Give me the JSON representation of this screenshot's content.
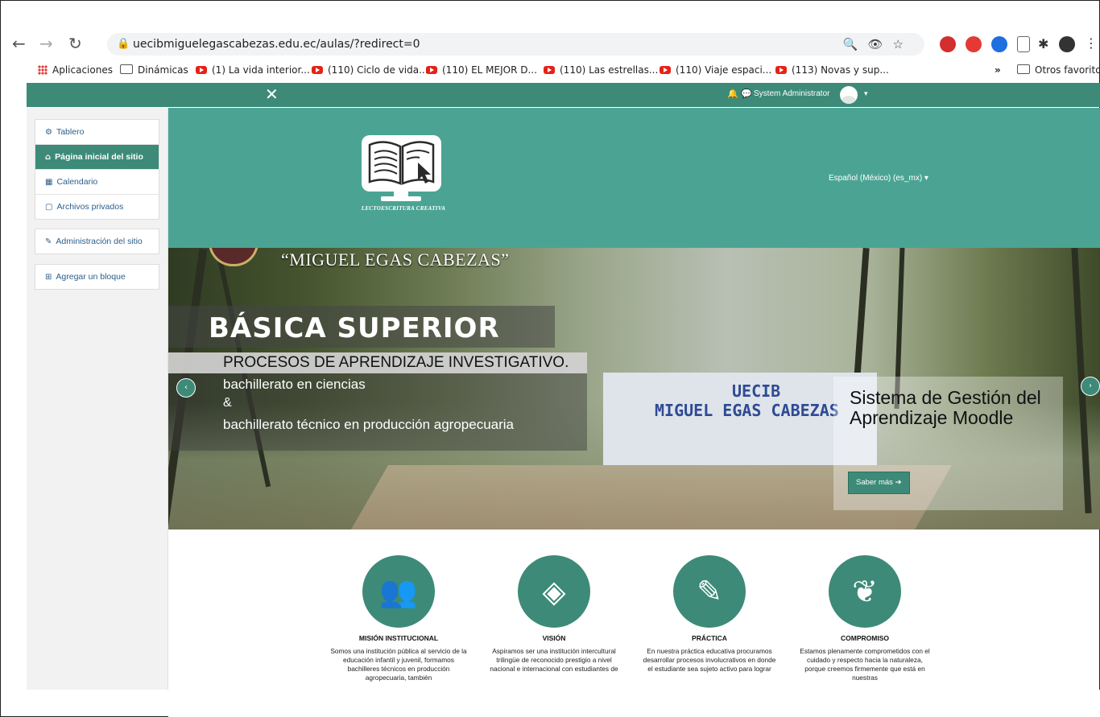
{
  "browser": {
    "url": "uecibmiguelegascabezas.edu.ec/aulas/?redirect=0",
    "bookmarks": [
      {
        "label": "Aplicaciones",
        "type": "apps"
      },
      {
        "label": "Dinámicas",
        "type": "folder"
      },
      {
        "label": "(1) La vida interior...",
        "type": "youtube"
      },
      {
        "label": "(110) Ciclo de vida...",
        "type": "youtube"
      },
      {
        "label": "(110) EL MEJOR D...",
        "type": "youtube"
      },
      {
        "label": "(110) Las estrellas...",
        "type": "youtube"
      },
      {
        "label": "(110) Viaje espaci...",
        "type": "youtube"
      },
      {
        "label": "(113) Novas y sup...",
        "type": "youtube"
      }
    ],
    "more_bookmarks": "»",
    "other_favorites": "Otros favoritos",
    "icons": [
      "back-icon",
      "forward-icon",
      "reload-icon",
      "lock-icon",
      "zoom-icon",
      "eye-icon",
      "star-icon"
    ]
  },
  "navbar": {
    "close_glyph": "✕",
    "user_name": "System Administrator",
    "caret": "▾"
  },
  "drawer": {
    "block1": [
      {
        "label": "Tablero",
        "icon": "dashboard-icon",
        "glyph": "⚙",
        "active": false
      },
      {
        "label": "Página inicial del sitio",
        "icon": "home-icon",
        "glyph": "⌂",
        "active": true
      },
      {
        "label": "Calendario",
        "icon": "calendar-icon",
        "glyph": "▦",
        "active": false
      },
      {
        "label": "Archivos privados",
        "icon": "file-icon",
        "glyph": "▢",
        "active": false
      }
    ],
    "block2": [
      {
        "label": "Administración del sitio",
        "icon": "wrench-icon",
        "glyph": "✎"
      }
    ],
    "block3": [
      {
        "label": "Agregar un bloque",
        "icon": "plus-icon",
        "glyph": "⊞"
      }
    ]
  },
  "header": {
    "logo_text": "LECTOESCRITURA CREATIVA",
    "language": "Español (México) (es_mx) ▾"
  },
  "hero": {
    "school_name": "“MIGUEL EGAS CABEZAS”",
    "basica": "BÁSICA SUPERIOR",
    "procesos": "PROCESOS DE APRENDIZAJE INVESTIGATIVO.",
    "line1": "bachillerato en ciencias",
    "line2": "&",
    "line3": "bachillerato técnico en producción agropecuaria",
    "wall_line1": "UECIB",
    "wall_line2": "MIGUEL EGAS CABEZAS",
    "caption_title": "Sistema de Gestión del Aprendizaje Moodle",
    "caption_button": "Saber más ➔",
    "prev_glyph": "‹",
    "next_glyph": "›"
  },
  "features": [
    {
      "title": "MISIÓN INSTITUCIONAL",
      "icon": "users-icon",
      "glyph": "👥",
      "text": "Somos una institución pública al servicio de la educación infantil y juvenil, formamos bachilleres técnicos en producción agropecuaria, también"
    },
    {
      "title": "VISIÓN",
      "icon": "eye-slash-icon",
      "glyph": "◈",
      "text": "Aspiramos ser una institución intercultural trilingüe de reconocido prestigio a nivel nacional e internacional con estudiantes de"
    },
    {
      "title": "PRÁCTICA",
      "icon": "edit-icon",
      "glyph": "✎",
      "text": "En nuestra práctica educativa procuramos desarrollar procesos involucrativos en donde el estudiante sea sujeto activo para lograr"
    },
    {
      "title": "COMPROMISO",
      "icon": "leaf-icon",
      "glyph": "❦",
      "text": "Estamos plenamente comprometidos con el cuidado y respecto hacia la naturaleza, porque creemos firmemente que está en nuestras"
    }
  ]
}
